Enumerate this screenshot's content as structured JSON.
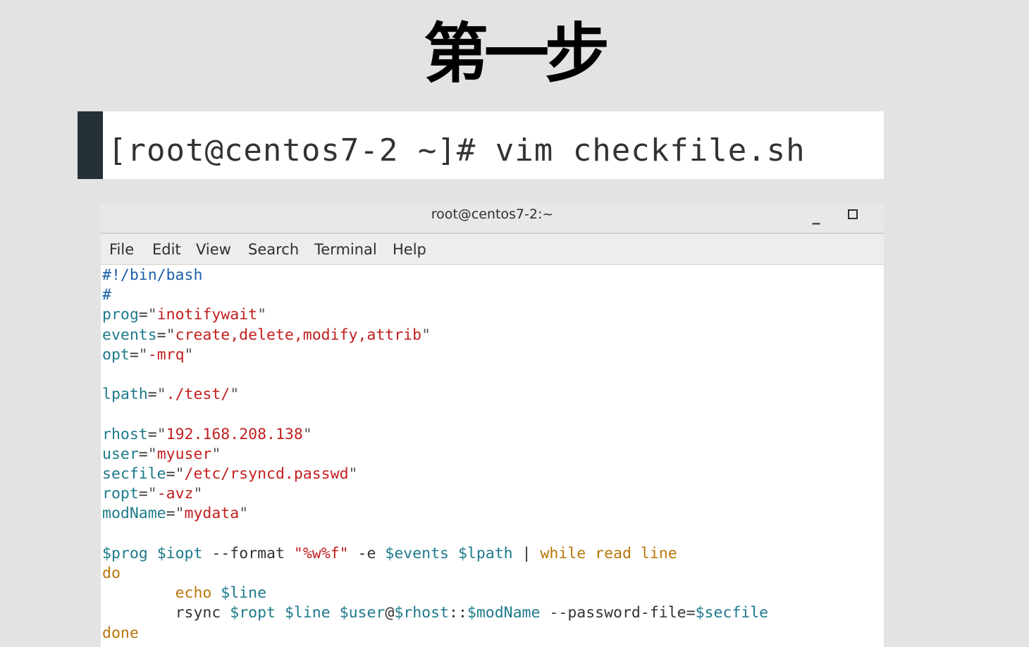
{
  "slide": {
    "title": "第一步"
  },
  "command_crop": {
    "command": "[root@centos7-2 ~]# vim checkfile.sh"
  },
  "terminal": {
    "window_title": "root@centos7-2:~",
    "minimize_glyph": "_",
    "menu": [
      "File",
      "Edit",
      "View",
      "Search",
      "Terminal",
      "Help"
    ],
    "script_lines": [
      "#!/bin/bash",
      "#",
      "prog=\"inotifywait\"",
      "events=\"create,delete,modify,attrib\"",
      "opt=\"-mrq\"",
      "",
      "lpath=\"./test/\"",
      "",
      "rhost=\"192.168.208.138\"",
      "user=\"myuser\"",
      "secfile=\"/etc/rsyncd.passwd\"",
      "ropt=\"-avz\"",
      "modName=\"mydata\"",
      "",
      "$prog $iopt --format \"%w%f\" -e $events $lpath | while read line",
      "do",
      "        echo $line",
      "        rsync $ropt $line $user@$rhost::$modName --password-file=$secfile",
      "done"
    ]
  },
  "colors": {
    "variable": "#1d7a8a",
    "string": "#c21e1e",
    "keyword": "#b8760b",
    "comment": "#1a5fa8"
  }
}
